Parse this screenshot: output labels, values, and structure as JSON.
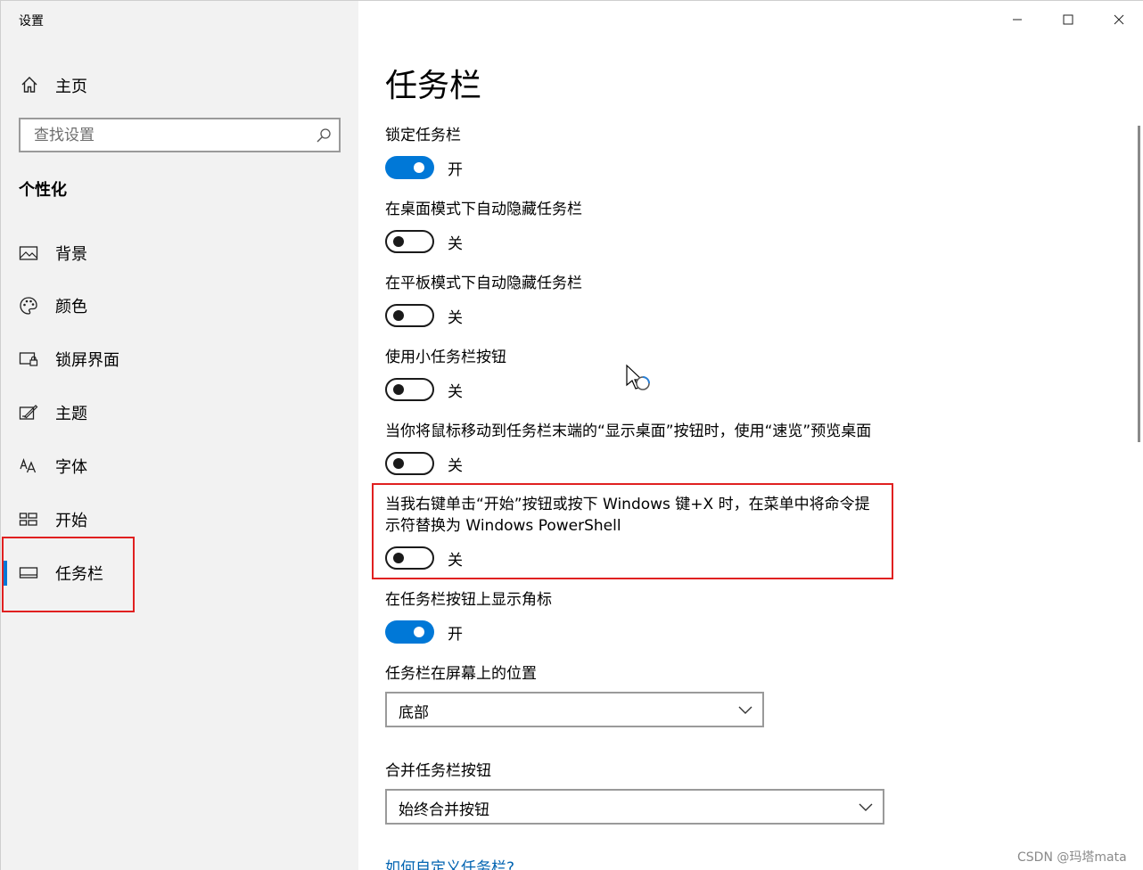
{
  "window": {
    "title": "设置"
  },
  "sidebar": {
    "home_label": "主页",
    "search_placeholder": "查找设置",
    "section_title": "个性化",
    "items": [
      {
        "label": "背景",
        "icon": "picture-icon"
      },
      {
        "label": "颜色",
        "icon": "palette-icon"
      },
      {
        "label": "锁屏界面",
        "icon": "lock-screen-icon"
      },
      {
        "label": "主题",
        "icon": "theme-icon"
      },
      {
        "label": "字体",
        "icon": "font-icon"
      },
      {
        "label": "开始",
        "icon": "start-icon"
      },
      {
        "label": "任务栏",
        "icon": "taskbar-icon",
        "selected": true
      }
    ]
  },
  "main": {
    "title": "任务栏",
    "settings": [
      {
        "label": "锁定任务栏",
        "state": "开",
        "on": true
      },
      {
        "label": "在桌面模式下自动隐藏任务栏",
        "state": "关",
        "on": false
      },
      {
        "label": "在平板模式下自动隐藏任务栏",
        "state": "关",
        "on": false
      },
      {
        "label": "使用小任务栏按钮",
        "state": "关",
        "on": false
      },
      {
        "label": "当你将鼠标移动到任务栏末端的“显示桌面”按钮时，使用“速览”预览桌面",
        "state": "关",
        "on": false
      },
      {
        "label_line1": "当我右键单击“开始”按钮或按下 Windows 键+X 时，在菜单中将命令提",
        "label_line2": "示符替换为 Windows PowerShell",
        "state": "关",
        "on": false
      },
      {
        "label": "在任务栏按钮上显示角标",
        "state": "开",
        "on": true
      }
    ],
    "position": {
      "label": "任务栏在屏幕上的位置",
      "value": "底部"
    },
    "combine": {
      "label": "合并任务栏按钮",
      "value": "始终合并按钮"
    },
    "help_link": "如何自定义任务栏?"
  },
  "colors": {
    "accent": "#0078d7",
    "highlight": "#e02020",
    "link": "#0063b1"
  },
  "watermark": "CSDN @玛塔mata"
}
